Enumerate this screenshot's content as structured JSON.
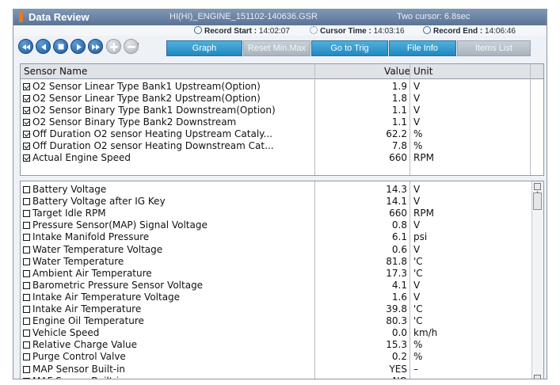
{
  "window": {
    "title": "Data Review",
    "file": "HI(HI)_ENGINE_151102-140636.GSR",
    "cursor_mode": "Two cursor: 6.8sec"
  },
  "info": {
    "record_start_label": "Record Start :",
    "record_start": "14:02:07",
    "cursor_time_label": "Cursor Time :",
    "cursor_time": "14:03:16",
    "record_end_label": "Record End :",
    "record_end": "14:06:46"
  },
  "toolbar": {
    "nav_icons": [
      "rewind-icon",
      "step-back-icon",
      "stop-icon",
      "play-icon",
      "fast-forward-icon",
      "zoom-in-icon",
      "zoom-out-icon"
    ],
    "buttons": [
      "Graph",
      "Reset Min.Max",
      "Go to Trig",
      "File Info",
      "Items List"
    ]
  },
  "table": {
    "col_name": "Sensor Name",
    "col_value": "Value",
    "col_unit": "Unit"
  },
  "selected_sensors": [
    {
      "name": "O2 Sensor Linear Type Bank1 Upstream(Option)",
      "value": "1.9",
      "unit": "V",
      "checked": true
    },
    {
      "name": "O2 Sensor Linear Type Bank2 Upstream(Option)",
      "value": "1.8",
      "unit": "V",
      "checked": true
    },
    {
      "name": "O2 Sensor Binary Type Bank1 Downstream(Option)",
      "value": "1.1",
      "unit": "V",
      "checked": true
    },
    {
      "name": "O2 Sensor Binary Type Bank2 Downstream",
      "value": "1.1",
      "unit": "V",
      "checked": true
    },
    {
      "name": "Off Duration O2 sensor Heating Upstream Cataly...",
      "value": "62.2",
      "unit": "%",
      "checked": true
    },
    {
      "name": "Off Duration O2 sensor Heating Downstream Cat...",
      "value": "7.8",
      "unit": "%",
      "checked": true
    },
    {
      "name": "Actual Engine Speed",
      "value": "660",
      "unit": "RPM",
      "checked": true
    }
  ],
  "other_sensors": [
    {
      "name": "Battery Voltage",
      "value": "14.3",
      "unit": "V",
      "checked": false
    },
    {
      "name": "Battery Voltage after IG Key",
      "value": "14.1",
      "unit": "V",
      "checked": false
    },
    {
      "name": "Target Idle RPM",
      "value": "660",
      "unit": "RPM",
      "checked": false
    },
    {
      "name": "Pressure Sensor(MAP) Signal Voltage",
      "value": "0.8",
      "unit": "V",
      "checked": false
    },
    {
      "name": "Intake Manifold Pressure",
      "value": "6.1",
      "unit": "psi",
      "checked": false
    },
    {
      "name": "Water Temperature Voltage",
      "value": "0.6",
      "unit": "V",
      "checked": false
    },
    {
      "name": "Water Temperature",
      "value": "81.8",
      "unit": "'C",
      "checked": false
    },
    {
      "name": "Ambient Air Temperature",
      "value": "17.3",
      "unit": "'C",
      "checked": false
    },
    {
      "name": "Barometric Pressure Sensor Voltage",
      "value": "4.1",
      "unit": "V",
      "checked": false
    },
    {
      "name": "Intake Air Temperature Voltage",
      "value": "1.6",
      "unit": "V",
      "checked": false
    },
    {
      "name": "Intake Air Temperature",
      "value": "39.8",
      "unit": "'C",
      "checked": false
    },
    {
      "name": "Engine Oil Temperature",
      "value": "80.3",
      "unit": "'C",
      "checked": false
    },
    {
      "name": "Vehicle Speed",
      "value": "0.0",
      "unit": "km/h",
      "checked": false
    },
    {
      "name": "Relative Charge Value",
      "value": "15.3",
      "unit": "%",
      "checked": false
    },
    {
      "name": "Purge Control Valve",
      "value": "0.2",
      "unit": "%",
      "checked": false
    },
    {
      "name": "MAP Sensor Built-in",
      "value": "YES",
      "unit": "–",
      "checked": false
    },
    {
      "name": "MAF Sensor Built-in",
      "value": "NO",
      "unit": "–",
      "checked": false
    }
  ]
}
